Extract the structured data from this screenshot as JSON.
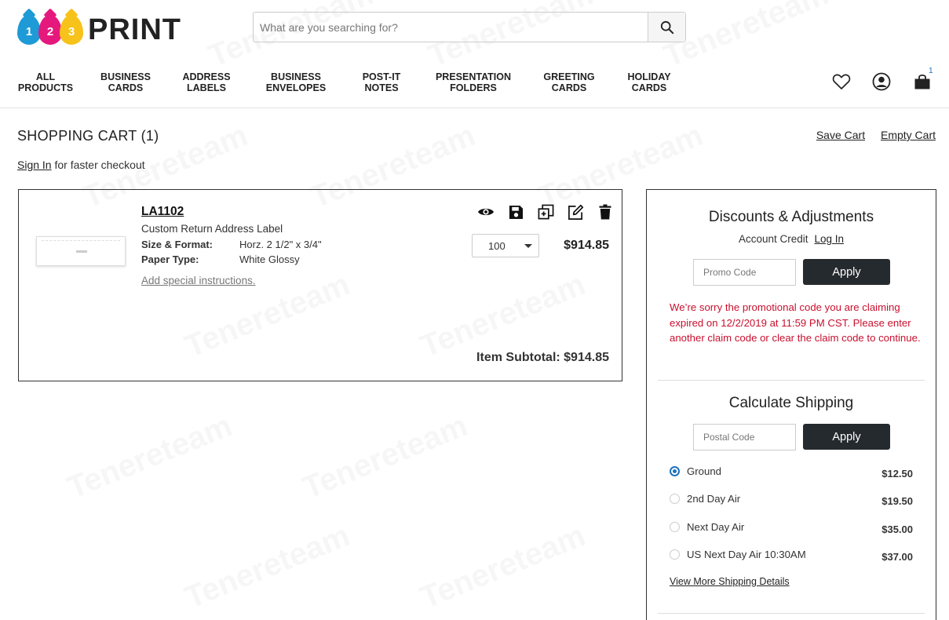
{
  "brand": {
    "logo_digits": [
      "1",
      "2",
      "3"
    ],
    "logo_word": "PRINT",
    "colors": {
      "cyan": "#1e9ad6",
      "magenta": "#e5197d",
      "yellow": "#f7c21a"
    }
  },
  "search": {
    "placeholder": "What are you searching for?",
    "icon": "search-icon"
  },
  "nav": [
    {
      "line1": "ALL",
      "line2": "PRODUCTS"
    },
    {
      "line1": "BUSINESS",
      "line2": "CARDS"
    },
    {
      "line1": "ADDRESS",
      "line2": "LABELS"
    },
    {
      "line1": "BUSINESS",
      "line2": "ENVELOPES"
    },
    {
      "line1": "POST-IT",
      "line2": "NOTES"
    },
    {
      "line1": "PRESENTATION",
      "line2": "FOLDERS"
    },
    {
      "line1": "GREETING",
      "line2": "CARDS"
    },
    {
      "line1": "HOLIDAY",
      "line2": "CARDS"
    }
  ],
  "header_icons": {
    "wishlist": "heart-icon",
    "account": "user-icon",
    "cart": "shopping-bag-icon",
    "cart_count": "1"
  },
  "cart": {
    "title": "SHOPPING CART (1)",
    "save_cart": "Save Cart",
    "empty_cart": "Empty Cart",
    "sign_in": "Sign In",
    "sign_in_suffix": " for faster checkout"
  },
  "item": {
    "sku": "LA1102",
    "name": "Custom Return Address Label",
    "specs": [
      {
        "label": "Size & Format:",
        "value": "Horz. 2 1/2\" x 3/4\""
      },
      {
        "label": "Paper Type:",
        "value": "White Glossy"
      }
    ],
    "special_instructions": "Add special instructions.",
    "actions": [
      "eye-icon",
      "save-icon",
      "duplicate-icon",
      "edit-icon",
      "trash-icon"
    ],
    "quantity": "100",
    "price": "$914.85",
    "subtotal": "Item Subtotal: $914.85"
  },
  "discounts": {
    "title": "Discounts & Adjustments",
    "credit_label": "Account Credit",
    "login": "Log In",
    "promo_placeholder": "Promo Code",
    "apply": "Apply",
    "error": "We’re sorry the promotional code you are claiming expired on 12/2/2019 at 11:59 PM CST. Please enter another claim code or clear the claim code to continue."
  },
  "shipping": {
    "title": "Calculate Shipping",
    "postal_placeholder": "Postal Code",
    "apply": "Apply",
    "options": [
      {
        "name": "Ground",
        "cost": "$12.50",
        "selected": true
      },
      {
        "name": "2nd Day Air",
        "cost": "$19.50",
        "selected": false
      },
      {
        "name": "Next Day Air",
        "cost": "$35.00",
        "selected": false
      },
      {
        "name": "US Next Day Air 10:30AM",
        "cost": "$37.00",
        "selected": false
      }
    ],
    "more": "View More Shipping Details"
  },
  "watermark": "Tenereteam"
}
